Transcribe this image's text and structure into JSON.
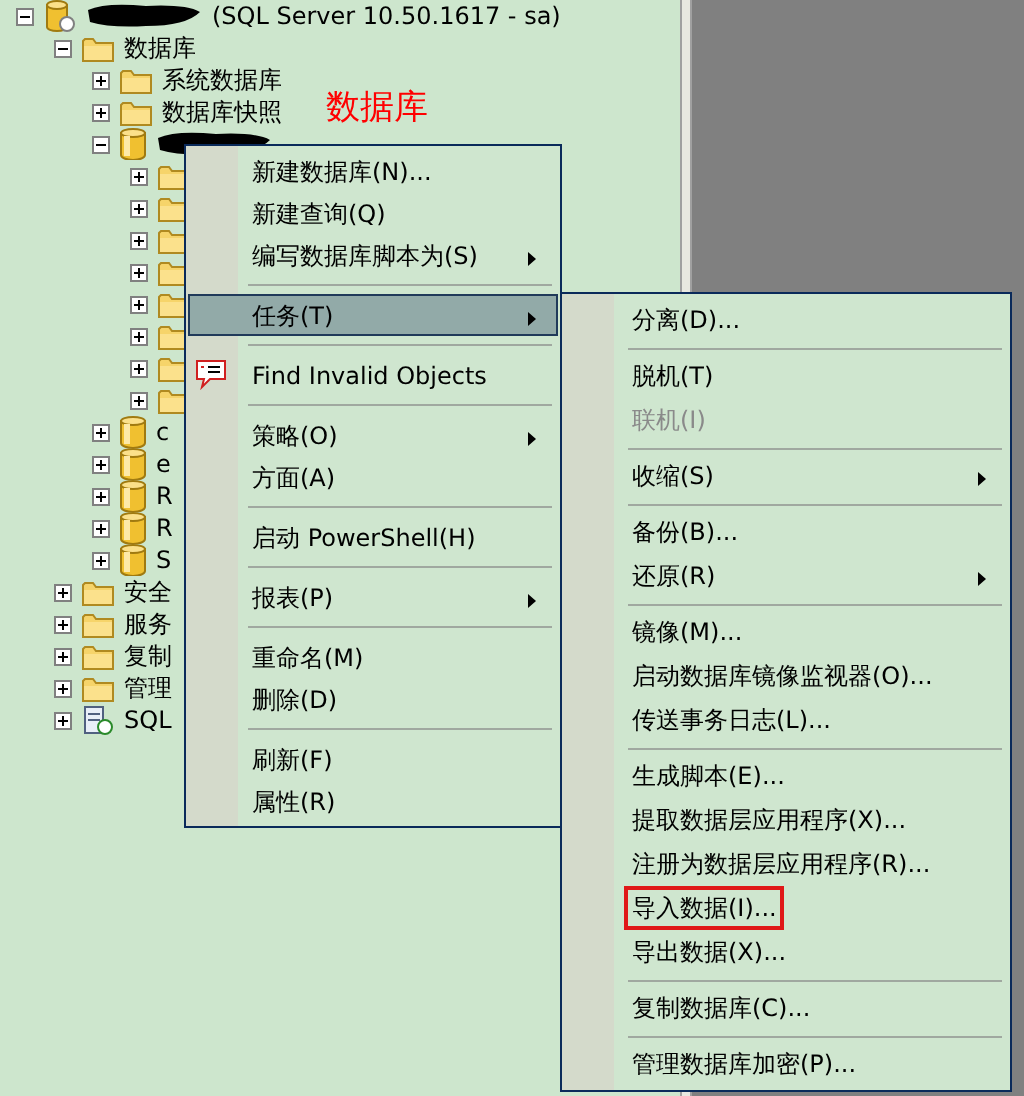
{
  "tree": [
    {
      "kind": "server",
      "label": "(SQL Server 10.50.1617 - sa)",
      "redacted": true,
      "expanded": true,
      "children": [
        {
          "kind": "folder",
          "label": "数据库",
          "expanded": true,
          "children": [
            {
              "kind": "folder",
              "label": "系统数据库",
              "expanded": false
            },
            {
              "kind": "folder",
              "label": "数据库快照",
              "expanded": false
            },
            {
              "kind": "database",
              "redacted": true,
              "expanded": true,
              "children": [
                {
                  "kind": "folder",
                  "expanded": false
                },
                {
                  "kind": "folder",
                  "expanded": false
                },
                {
                  "kind": "folder",
                  "expanded": false
                },
                {
                  "kind": "folder",
                  "expanded": false
                },
                {
                  "kind": "folder",
                  "expanded": false
                },
                {
                  "kind": "folder",
                  "expanded": false
                },
                {
                  "kind": "folder",
                  "expanded": false
                },
                {
                  "kind": "folder",
                  "expanded": false
                }
              ]
            },
            {
              "kind": "database",
              "label": "c",
              "expanded": false
            },
            {
              "kind": "database",
              "label": "e",
              "expanded": false
            },
            {
              "kind": "database",
              "label": "R",
              "expanded": false
            },
            {
              "kind": "database",
              "label": "R",
              "expanded": false
            },
            {
              "kind": "database",
              "label": "S",
              "expanded": false
            }
          ]
        },
        {
          "kind": "folder",
          "label": "安全",
          "expanded": false
        },
        {
          "kind": "folder",
          "label": "服务",
          "expanded": false
        },
        {
          "kind": "folder",
          "label": "复制",
          "expanded": false
        },
        {
          "kind": "folder",
          "label": "管理",
          "expanded": false
        },
        {
          "kind": "agent",
          "label": "SQL",
          "expanded": false
        }
      ]
    }
  ],
  "annotation": "数据库",
  "context_menu": [
    {
      "kind": "item",
      "label": "新建数据库(N)...",
      "submenu": false,
      "selected": false
    },
    {
      "kind": "item",
      "label": "新建查询(Q)",
      "submenu": false,
      "selected": false
    },
    {
      "kind": "item",
      "label": "编写数据库脚本为(S)",
      "submenu": true,
      "selected": false
    },
    {
      "kind": "separator"
    },
    {
      "kind": "item",
      "label": "任务(T)",
      "submenu": true,
      "selected": true
    },
    {
      "kind": "separator"
    },
    {
      "kind": "icon_item",
      "label": "Find Invalid Objects",
      "submenu": false,
      "selected": false
    },
    {
      "kind": "separator"
    },
    {
      "kind": "item",
      "label": "策略(O)",
      "submenu": true,
      "selected": false
    },
    {
      "kind": "item",
      "label": "方面(A)",
      "submenu": false,
      "selected": false
    },
    {
      "kind": "separator"
    },
    {
      "kind": "item",
      "label": "启动 PowerShell(H)",
      "submenu": false,
      "selected": false
    },
    {
      "kind": "separator"
    },
    {
      "kind": "item",
      "label": "报表(P)",
      "submenu": true,
      "selected": false
    },
    {
      "kind": "separator"
    },
    {
      "kind": "item",
      "label": "重命名(M)",
      "submenu": false,
      "selected": false
    },
    {
      "kind": "item",
      "label": "删除(D)",
      "submenu": false,
      "selected": false
    },
    {
      "kind": "separator"
    },
    {
      "kind": "item",
      "label": "刷新(F)",
      "submenu": false,
      "selected": false
    },
    {
      "kind": "item",
      "label": "属性(R)",
      "submenu": false,
      "selected": false
    }
  ],
  "tasks_submenu": [
    {
      "kind": "item",
      "label": "分离(D)...",
      "submenu": false,
      "disabled": false,
      "highlighted": false
    },
    {
      "kind": "separator"
    },
    {
      "kind": "item",
      "label": "脱机(T)",
      "submenu": false,
      "disabled": false,
      "highlighted": false
    },
    {
      "kind": "item",
      "label": "联机(I)",
      "submenu": false,
      "disabled": true,
      "highlighted": false
    },
    {
      "kind": "separator"
    },
    {
      "kind": "item",
      "label": "收缩(S)",
      "submenu": true,
      "disabled": false,
      "highlighted": false
    },
    {
      "kind": "separator"
    },
    {
      "kind": "item",
      "label": "备份(B)...",
      "submenu": false,
      "disabled": false,
      "highlighted": false
    },
    {
      "kind": "item",
      "label": "还原(R)",
      "submenu": true,
      "disabled": false,
      "highlighted": false
    },
    {
      "kind": "separator"
    },
    {
      "kind": "item",
      "label": "镜像(M)...",
      "submenu": false,
      "disabled": false,
      "highlighted": false
    },
    {
      "kind": "item",
      "label": "启动数据库镜像监视器(O)...",
      "submenu": false,
      "disabled": false,
      "highlighted": false
    },
    {
      "kind": "item",
      "label": "传送事务日志(L)...",
      "submenu": false,
      "disabled": false,
      "highlighted": false
    },
    {
      "kind": "separator"
    },
    {
      "kind": "item",
      "label": "生成脚本(E)...",
      "submenu": false,
      "disabled": false,
      "highlighted": false
    },
    {
      "kind": "item",
      "label": "提取数据层应用程序(X)...",
      "submenu": false,
      "disabled": false,
      "highlighted": false
    },
    {
      "kind": "item",
      "label": "注册为数据层应用程序(R)...",
      "submenu": false,
      "disabled": false,
      "highlighted": false
    },
    {
      "kind": "item",
      "label": "导入数据(I)...",
      "submenu": false,
      "disabled": false,
      "highlighted": true
    },
    {
      "kind": "item",
      "label": "导出数据(X)...",
      "submenu": false,
      "disabled": false,
      "highlighted": false
    },
    {
      "kind": "separator"
    },
    {
      "kind": "item",
      "label": "复制数据库(C)...",
      "submenu": false,
      "disabled": false,
      "highlighted": false
    },
    {
      "kind": "separator"
    },
    {
      "kind": "item",
      "label": "管理数据库加密(P)...",
      "submenu": false,
      "disabled": false,
      "highlighted": false
    }
  ]
}
